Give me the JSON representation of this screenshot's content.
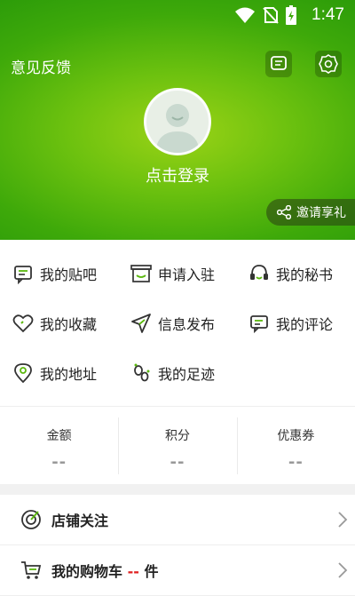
{
  "status_bar": {
    "time": "1:47"
  },
  "header": {
    "feedback_label": "意见反馈",
    "login_label": "点击登录",
    "invite_label": "邀请享礼"
  },
  "grid": {
    "rows": [
      [
        {
          "label": "我的贴吧",
          "icon": "post-icon"
        },
        {
          "label": "申请入驻",
          "icon": "shop-icon"
        },
        {
          "label": "我的秘书",
          "icon": "headset-icon"
        }
      ],
      [
        {
          "label": "我的收藏",
          "icon": "heart-icon"
        },
        {
          "label": "信息发布",
          "icon": "send-icon"
        },
        {
          "label": "我的评论",
          "icon": "comment-icon"
        }
      ],
      [
        {
          "label": "我的地址",
          "icon": "location-icon"
        },
        {
          "label": "我的足迹",
          "icon": "footprint-icon"
        }
      ]
    ]
  },
  "stats": [
    {
      "label": "金额",
      "value": "--"
    },
    {
      "label": "积分",
      "value": "--"
    },
    {
      "label": "优惠券",
      "value": "--"
    }
  ],
  "list": [
    {
      "label": "店铺关注",
      "icon": "target-icon"
    },
    {
      "label_prefix": "我的购物车",
      "count": "--",
      "label_suffix": "件",
      "icon": "cart-icon"
    }
  ],
  "colors": {
    "accent": "#5bb80e",
    "count": "#e02020"
  }
}
